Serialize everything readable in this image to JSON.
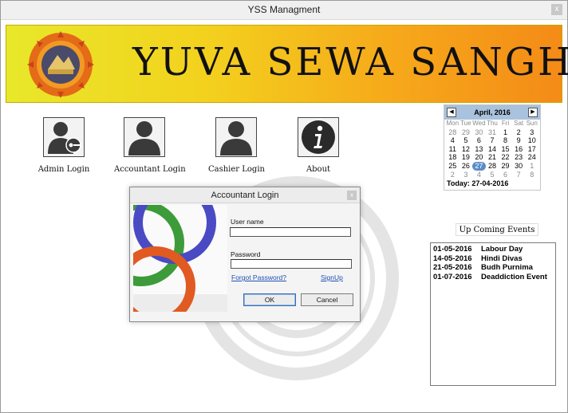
{
  "window": {
    "title": "YSS Managment",
    "close_glyph": "x"
  },
  "banner": {
    "title": "YUVA SEWA SANGH"
  },
  "logins": [
    {
      "label": "Admin Login",
      "icon": "admin-key-icon"
    },
    {
      "label": "Accountant Login",
      "icon": "user-silhouette-icon"
    },
    {
      "label": "Cashier Login",
      "icon": "user-silhouette-icon"
    },
    {
      "label": "About",
      "icon": "info-icon"
    }
  ],
  "calendar": {
    "month_label": "April, 2016",
    "prev_glyph": "◀",
    "next_glyph": "▶",
    "weekdays": [
      "Mon",
      "Tue",
      "Wed",
      "Thu",
      "Fri",
      "Sat",
      "Sun"
    ],
    "days": [
      "28",
      "29",
      "30",
      "31",
      "1",
      "2",
      "3",
      "4",
      "5",
      "6",
      "7",
      "8",
      "9",
      "10",
      "11",
      "12",
      "13",
      "14",
      "15",
      "16",
      "17",
      "18",
      "19",
      "20",
      "21",
      "22",
      "23",
      "24",
      "25",
      "26",
      "27",
      "28",
      "29",
      "30",
      "1",
      "2",
      "3",
      "4",
      "5",
      "6",
      "7",
      "8"
    ],
    "today_label": "Today: 27-04-2016"
  },
  "events": {
    "title": "Up Coming Events",
    "items": [
      {
        "date": "01-05-2016",
        "name": "Labour Day"
      },
      {
        "date": "14-05-2016",
        "name": "Hindi Divas"
      },
      {
        "date": "21-05-2016",
        "name": "Budh Purnima"
      },
      {
        "date": "01-07-2016",
        "name": "Deaddiction Event"
      }
    ]
  },
  "dialog": {
    "title": "Accountant Login",
    "close_glyph": "x",
    "username_label": "User name",
    "username_value": "",
    "password_label": "Password",
    "password_value": "",
    "forgot_label": "Forgot Password?",
    "signup_label": "SignUp",
    "ok_label": "OK",
    "cancel_label": "Cancel"
  },
  "colors": {
    "banner_start": "#e8e82a",
    "banner_end": "#f48b17",
    "link": "#1f4fb4",
    "calendar_header": "#a9c2dd"
  }
}
